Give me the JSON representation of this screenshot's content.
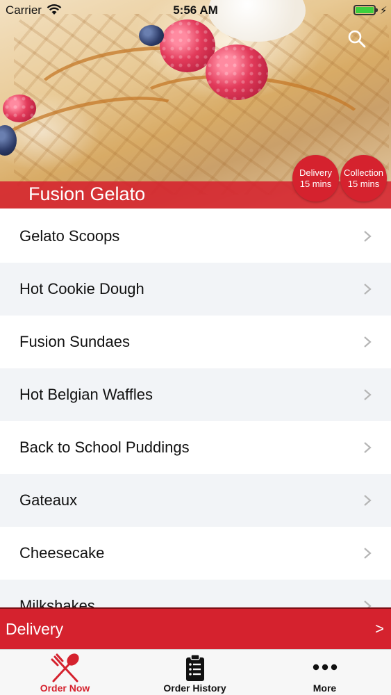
{
  "status_bar": {
    "carrier": "Carrier",
    "time": "5:56 AM"
  },
  "header": {
    "brand_name": "Fusion Gelato",
    "delivery_badge": {
      "label": "Delivery",
      "time": "15 mins"
    },
    "collection_badge": {
      "label": "Collection",
      "time": "15 mins"
    }
  },
  "menu": {
    "items": [
      {
        "label": "Gelato Scoops"
      },
      {
        "label": "Hot Cookie Dough"
      },
      {
        "label": "Fusion Sundaes"
      },
      {
        "label": "Hot Belgian Waffles"
      },
      {
        "label": "Back to School Puddings"
      },
      {
        "label": "Gateaux"
      },
      {
        "label": "Cheesecake"
      },
      {
        "label": "Milkshakes"
      }
    ]
  },
  "delivery_bar": {
    "label": "Delivery",
    "arrow": ">"
  },
  "tabs": [
    {
      "label": "Order Now",
      "icon": "fork-spoon-icon",
      "active": true
    },
    {
      "label": "Order History",
      "icon": "clipboard-list-icon",
      "active": false
    },
    {
      "label": "More",
      "icon": "more-dots-icon",
      "active": false
    }
  ],
  "colors": {
    "brand_red": "#d5222e",
    "alt_row": "#f2f4f7",
    "tab_bar": "#f7f7f7"
  }
}
